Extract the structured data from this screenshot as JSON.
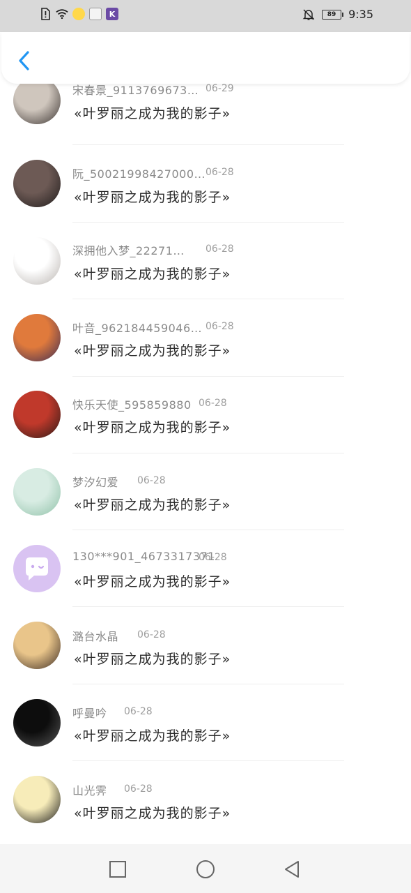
{
  "status_bar": {
    "time": "9:35",
    "battery": "89",
    "icons": [
      "alert-icon",
      "wifi-icon",
      "app-icon",
      "app-icon",
      "k-app-icon",
      "bell-off-icon"
    ],
    "k_app_label": "K"
  },
  "header": {
    "back_icon": "chevron-left-icon",
    "accent_color": "#2196f3"
  },
  "comments": [
    {
      "name": "宋春景_9113769673…",
      "date": "06-29",
      "message": "«叶罗丽之成为我的影子»",
      "avatar_colors": [
        "#cfc6bd",
        "#3a3330"
      ]
    },
    {
      "name": "阮_50021998427000…",
      "date": "06-28",
      "message": "«叶罗丽之成为我的影子»",
      "avatar_colors": [
        "#6d5a55",
        "#1f1b1b"
      ]
    },
    {
      "name": "深拥他入梦_22271…",
      "date": "06-28",
      "message": "«叶罗丽之成为我的影子»",
      "avatar_colors": [
        "#ffffff",
        "#b9b4b0"
      ]
    },
    {
      "name": "叶音_962184459046…",
      "date": "06-28",
      "message": "«叶罗丽之成为我的影子»",
      "avatar_colors": [
        "#e07a3c",
        "#3b2b54"
      ]
    },
    {
      "name": "快乐天使_595859880",
      "date": "06-28",
      "message": "«叶罗丽之成为我的影子»",
      "avatar_colors": [
        "#c0392b",
        "#2b1a17"
      ]
    },
    {
      "name": "梦汐幻爱",
      "date": "06-28",
      "message": "«叶罗丽之成为我的影子»",
      "avatar_colors": [
        "#d8ece3",
        "#8fc1a8"
      ]
    },
    {
      "name": "130***901_4673317371",
      "date": "06-28",
      "message": "«叶罗丽之成为我的影子»",
      "avatar_colors": [
        "#d9c3f2",
        "#d9c3f2"
      ]
    },
    {
      "name": "潞台水晶",
      "date": "06-28",
      "message": "«叶罗丽之成为我的影子»",
      "avatar_colors": [
        "#e9c58a",
        "#3c2c24"
      ]
    },
    {
      "name": "呼曼吟",
      "date": "06-28",
      "message": "«叶罗丽之成为我的影子»",
      "avatar_colors": [
        "#0d0d0d",
        "#555555"
      ]
    },
    {
      "name": "山光霁",
      "date": "06-28",
      "message": "«叶罗丽之成为我的影子»",
      "avatar_colors": [
        "#f7ecb9",
        "#1a1a1a"
      ]
    }
  ],
  "nav_bar": {
    "buttons": [
      "recent-apps-icon",
      "home-icon",
      "back-triangle-icon"
    ]
  }
}
